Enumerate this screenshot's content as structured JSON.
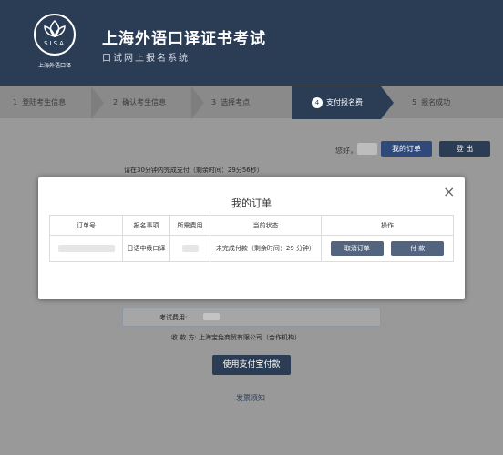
{
  "header": {
    "logo_letters": "SISA",
    "logo_caption": "上海外语口译",
    "title": "上海外语口译证书考试",
    "subtitle": "口试网上报名系统"
  },
  "steps": [
    {
      "num": "1",
      "label": "登陆考生信息"
    },
    {
      "num": "2",
      "label": "确认考生信息"
    },
    {
      "num": "3",
      "label": "选择考点"
    },
    {
      "num": "4",
      "label": "支付报名费"
    },
    {
      "num": "5",
      "label": "报名成功"
    }
  ],
  "userbar": {
    "greeting": "您好，",
    "my_orders": "我的订单",
    "logout": "登 出"
  },
  "hint": "请在30分钟内完成支付（剩余时间：29分56秒）",
  "modal": {
    "title": "我的订单",
    "close": "×",
    "columns": [
      "订单号",
      "报名事项",
      "所需费用",
      "当前状态",
      "操作"
    ],
    "row": {
      "item": "日语中级口译",
      "status": "未完成付款（剩余时间：29 分钟）",
      "cancel": "取消订单",
      "pay": "付 款"
    }
  },
  "payment": {
    "fee_label": "考试费用:",
    "payee": "收 款 方:  上海宝兔商贸有限公司（合作机构）",
    "alipay_button": "使用支付宝付款",
    "invoice_link": "发票须知"
  }
}
